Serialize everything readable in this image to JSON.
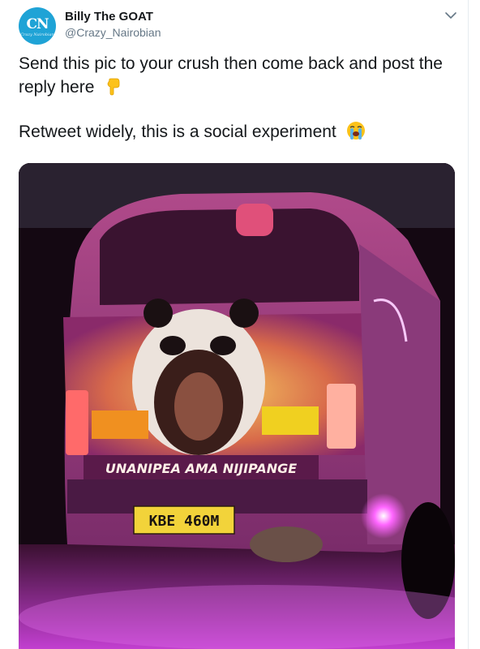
{
  "user": {
    "display_name": "Billy The GOAT",
    "handle": "@Crazy_Nairobian",
    "avatar_text": "CN",
    "avatar_subtext": "Crazy Nairobian"
  },
  "tweet": {
    "line1": "Send this pic to your crush then come back and post the reply here",
    "line2": "Retweet widely, this is a social experiment"
  },
  "media": {
    "vehicle_slogan": "UNANIPEA AMA NIJIPANGE",
    "plate": "KBE 460M"
  },
  "icons": {
    "menu": "chevron-down-icon",
    "emoji1": "backhand-index-pointing-down-icon",
    "emoji2": "loudly-crying-face-icon"
  },
  "colors": {
    "avatar_bg": "#1fa3d6",
    "handle": "#657786",
    "text": "#14171a"
  }
}
